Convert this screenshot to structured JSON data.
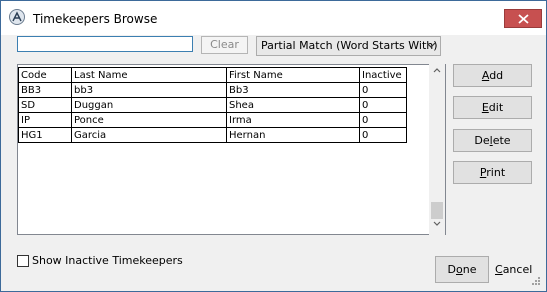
{
  "window": {
    "title": "Timekeepers Browse"
  },
  "search": {
    "value": "",
    "clear_label": "Clear"
  },
  "match_mode": {
    "selected": "Partial Match (Word Starts With)"
  },
  "grid": {
    "columns": [
      "Code",
      "Last Name",
      "First Name",
      "Inactive"
    ],
    "rows": [
      [
        "BB3",
        "bb3",
        "Bb3",
        "0"
      ],
      [
        "SD",
        "Duggan",
        "Shea",
        "0"
      ],
      [
        "IP",
        "Ponce",
        "Irma",
        "0"
      ],
      [
        "HG1",
        "Garcia",
        "Hernan",
        "0"
      ]
    ]
  },
  "actions": {
    "add": {
      "accel": "A",
      "rest": "dd"
    },
    "edit": {
      "accel": "E",
      "rest": "dit"
    },
    "delete": {
      "pre": "De",
      "accel": "l",
      "rest": "ete"
    },
    "print": {
      "accel": "P",
      "rest": "rint"
    }
  },
  "show_inactive": {
    "label": "Show Inactive Timekeepers",
    "checked": false
  },
  "footer": {
    "done": {
      "pre": "D",
      "accel": "o",
      "rest": "ne"
    },
    "cancel": {
      "accel": "C",
      "rest": "ancel"
    }
  }
}
